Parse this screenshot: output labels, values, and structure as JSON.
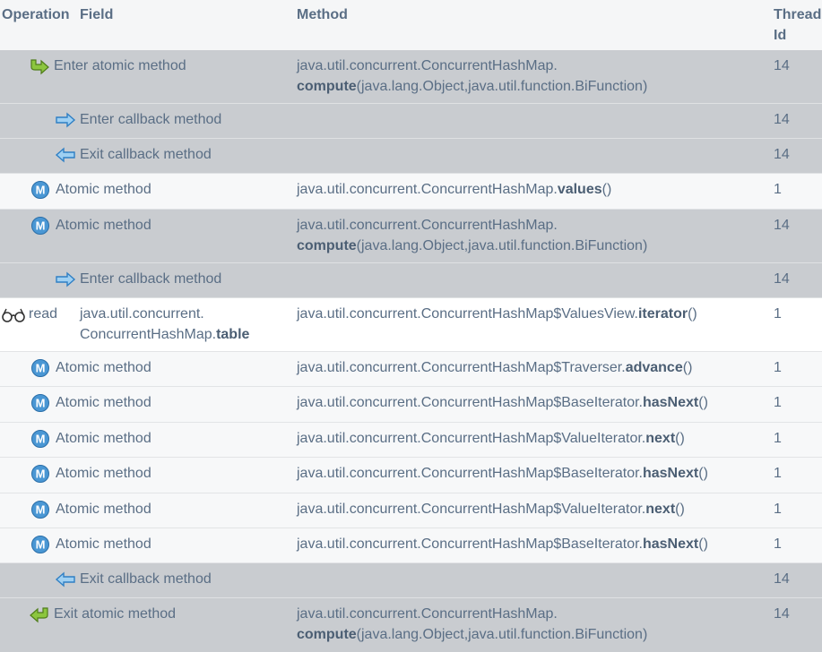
{
  "headers": {
    "operation": "Operation",
    "field": "Field",
    "method": "Method",
    "thread": "Thread Id"
  },
  "rows": [
    {
      "op": "Enter atomic method",
      "method_l1": "java.util.concurrent.ConcurrentHashMap.",
      "method_bold": "compute",
      "method_rest": "(java.lang.Object,java.util.function.BiFunction)",
      "thread": "14"
    },
    {
      "op": "Enter callback method",
      "thread": "14"
    },
    {
      "op": "Exit callback method",
      "thread": "14"
    },
    {
      "op": "Atomic method",
      "method_pre": "java.util.concurrent.ConcurrentHashMap.",
      "method_bold": "values",
      "method_rest": "()",
      "thread": "1"
    },
    {
      "op": "Atomic method",
      "method_l1": "java.util.concurrent.ConcurrentHashMap.",
      "method_bold": "compute",
      "method_rest": "(java.lang.Object,java.util.function.BiFunction)",
      "thread": "14"
    },
    {
      "op": "Enter callback method",
      "thread": "14"
    },
    {
      "op": "read",
      "field_l1": "java.util.concurrent.",
      "field_pre": "ConcurrentHashMap.",
      "field_bold": "table",
      "method_pre": "java.util.concurrent.ConcurrentHashMap$ValuesView.",
      "method_bold": "iterator",
      "method_rest": "()",
      "thread": "1"
    },
    {
      "op": "Atomic method",
      "method_pre": "java.util.concurrent.ConcurrentHashMap$Traverser.",
      "method_bold": "advance",
      "method_rest": "()",
      "thread": "1"
    },
    {
      "op": "Atomic method",
      "method_pre": "java.util.concurrent.ConcurrentHashMap$BaseIterator.",
      "method_bold": "hasNext",
      "method_rest": "()",
      "thread": "1"
    },
    {
      "op": "Atomic method",
      "method_pre": "java.util.concurrent.ConcurrentHashMap$ValueIterator.",
      "method_bold": "next",
      "method_rest": "()",
      "thread": "1"
    },
    {
      "op": "Atomic method",
      "method_pre": "java.util.concurrent.ConcurrentHashMap$BaseIterator.",
      "method_bold": "hasNext",
      "method_rest": "()",
      "thread": "1"
    },
    {
      "op": "Atomic method",
      "method_pre": "java.util.concurrent.ConcurrentHashMap$ValueIterator.",
      "method_bold": "next",
      "method_rest": "()",
      "thread": "1"
    },
    {
      "op": "Atomic method",
      "method_pre": "java.util.concurrent.ConcurrentHashMap$BaseIterator.",
      "method_bold": "hasNext",
      "method_rest": "()",
      "thread": "1"
    },
    {
      "op": "Exit callback method",
      "thread": "14"
    },
    {
      "op": "Exit atomic method",
      "method_l1": "java.util.concurrent.ConcurrentHashMap.",
      "method_bold": "compute",
      "method_rest": "(java.lang.Object,java.util.function.BiFunction)",
      "thread": "14"
    }
  ],
  "icons": {
    "enter_atomic": "enter-atomic-arrow-icon",
    "exit_atomic": "exit-atomic-arrow-icon",
    "enter_callback": "enter-callback-arrow-icon",
    "exit_callback": "exit-callback-arrow-icon",
    "atomic": "method-m-icon",
    "read": "glasses-icon"
  },
  "colors": {
    "green_arrow": "#8cc63f",
    "blue_arrow": "#3a8fd1",
    "m_badge": "#3d8fd0",
    "gray_row": "#c9ccd0"
  }
}
